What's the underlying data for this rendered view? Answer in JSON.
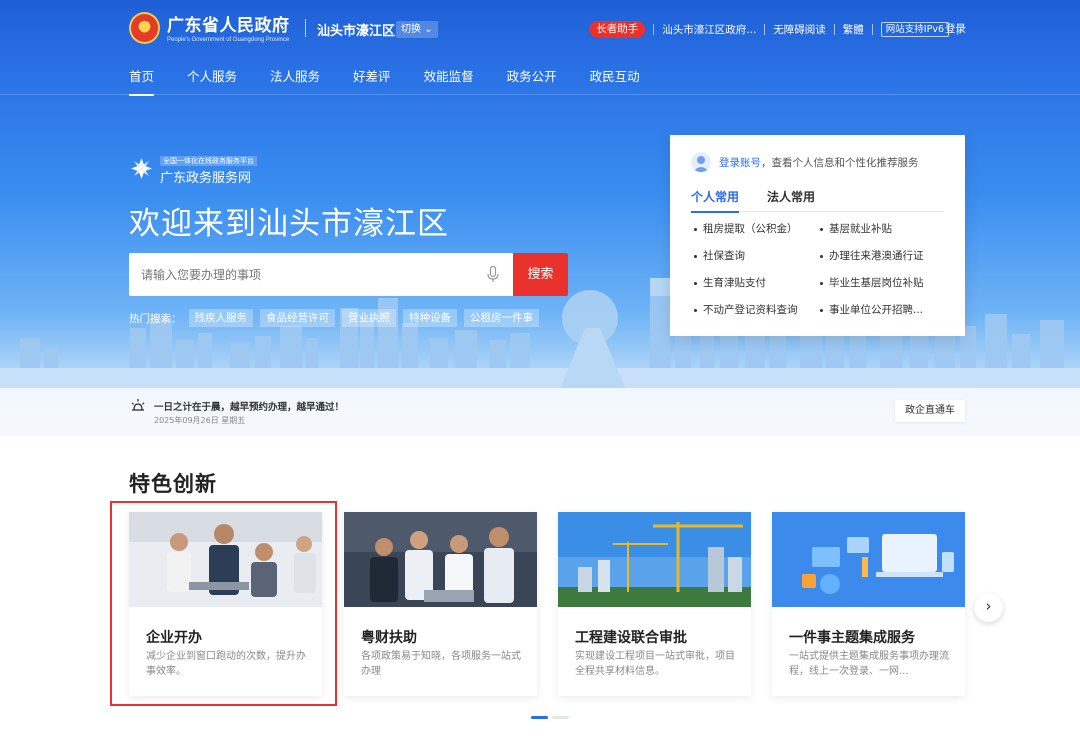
{
  "header": {
    "site_title": "广东省人民政府",
    "site_subtitle": "People's Government of Guangdong Province",
    "region": "汕头市濠江区",
    "switch_label": "切换",
    "top_links": {
      "elder": "长者助手",
      "region_gov": "汕头市濠江区政府...",
      "accessible": "无障碍阅读",
      "traditional": "繁體",
      "ipv6": "网站支持IPv6",
      "login": "登录"
    },
    "nav": [
      "首页",
      "个人服务",
      "法人服务",
      "好差评",
      "效能监督",
      "政务公开",
      "政民互动"
    ]
  },
  "hero": {
    "brand_small": "全国一体化在线政务服务平台",
    "brand_name": "广东政务服务网",
    "welcome": "欢迎来到汕头市濠江区",
    "search_placeholder": "请输入您要办理的事项",
    "search_button": "搜索",
    "hot_label": "热门搜索：",
    "hot_tags": [
      "残疾人服务",
      "食品经营许可",
      "营业执照",
      "特种设备",
      "公租房一件事"
    ]
  },
  "panel": {
    "login_link": "登录账号",
    "login_tip": "，查看个人信息和个性化推荐服务",
    "tabs": [
      "个人常用",
      "法人常用"
    ],
    "items": [
      "租房提取（公积金）",
      "基层就业补贴",
      "社保查询",
      "办理往来港澳通行证",
      "生育津贴支付",
      "毕业生基层岗位补贴",
      "不动产登记资料查询",
      "事业单位公开招聘..."
    ]
  },
  "notice": {
    "text": "一日之计在于晨，越早预约办理，越早通过！",
    "date": "2025年09月26日 星期五",
    "gov_button": "政企直通车"
  },
  "section": {
    "title": "特色创新",
    "cards": [
      {
        "title": "企业开办",
        "desc": "减少企业到窗口跑动的次数，提升办事效率。"
      },
      {
        "title": "粤财扶助",
        "desc": "各项政策易于知晓，各项服务一站式办理"
      },
      {
        "title": "工程建设联合审批",
        "desc": "实现建设工程项目一站式审批，项目全程共享材料信息。"
      },
      {
        "title": "一件事主题集成服务",
        "desc": "一站式提供主题集成服务事项办理流程，线上一次登录、一网..."
      }
    ],
    "next": "›"
  },
  "colors": {
    "primary": "#2a6ee8",
    "accent": "#e8322b",
    "hero_top": "#1f5fd6"
  }
}
